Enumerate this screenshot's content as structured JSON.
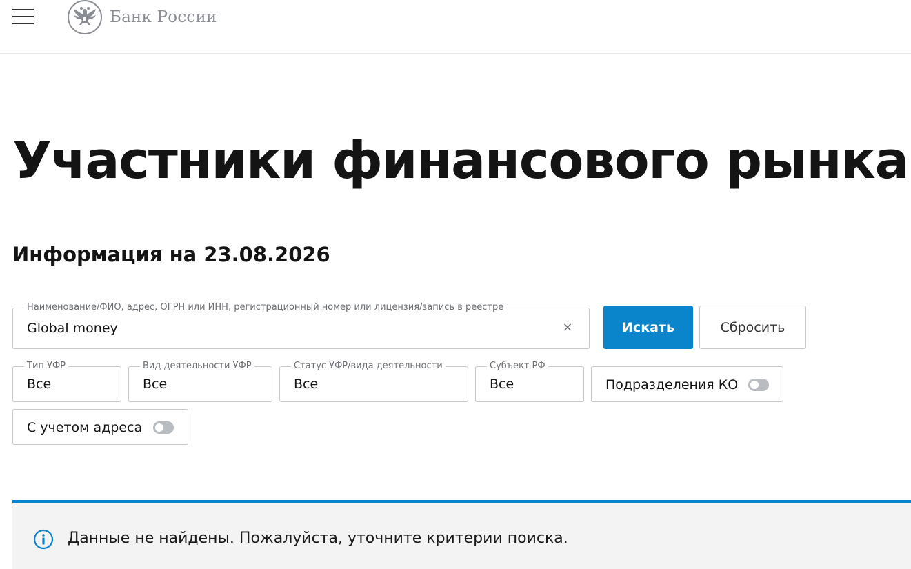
{
  "header": {
    "menu_icon": "hamburger-menu-icon",
    "logo_icon": "double-headed-eagle-emblem",
    "logo_text": "Банк России"
  },
  "main": {
    "title": "Участники финансового рынка",
    "subtitle": "Информация на 23.08.2026"
  },
  "search": {
    "label": "Наименование/ФИО, адрес, ОГРН или ИНН, регистрационный номер или лицензия/запись в реестре",
    "value": "Global money",
    "clear_icon": "close-icon",
    "search_button": "Искать",
    "reset_button": "Сбросить"
  },
  "filters": {
    "type": {
      "label": "Тип УФР",
      "value": "Все"
    },
    "activity": {
      "label": "Вид деятельности УФР",
      "value": "Все"
    },
    "status": {
      "label": "Статус УФР/вида деятельности",
      "value": "Все"
    },
    "region": {
      "label": "Субъект РФ",
      "value": "Все"
    },
    "ko_divisions": {
      "label": "Подразделения КО",
      "enabled": false
    },
    "with_address": {
      "label": "С учетом адреса",
      "enabled": false
    }
  },
  "alert": {
    "icon": "info-circle-icon",
    "text": "Данные не найдены. Пожалуйста, уточните критерии поиска."
  },
  "colors": {
    "accent": "#0a84ca",
    "alert_background": "#f3f3f3",
    "toggle_off": "#b9bcc1"
  }
}
